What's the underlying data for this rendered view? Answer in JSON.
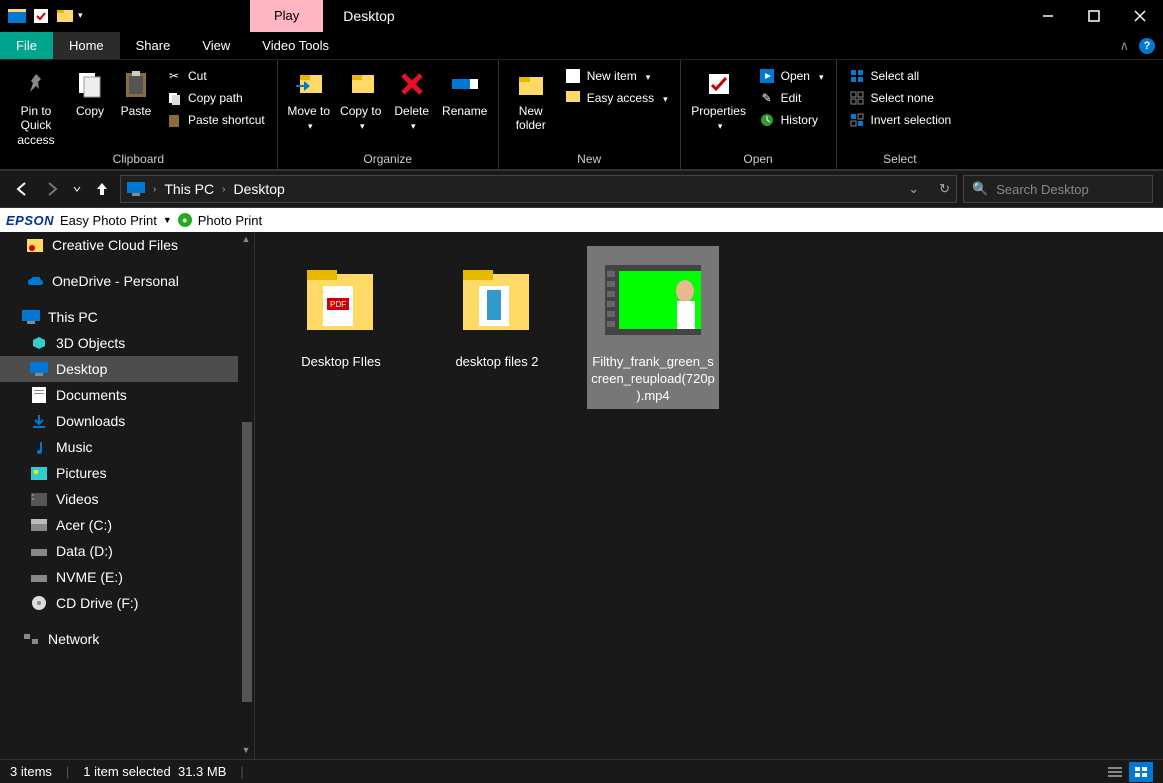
{
  "window": {
    "context_tab": "Play",
    "title": "Desktop"
  },
  "tabs": {
    "file": "File",
    "home": "Home",
    "share": "Share",
    "view": "View",
    "video_tools": "Video Tools"
  },
  "ribbon": {
    "clipboard": {
      "label": "Clipboard",
      "pin": "Pin to Quick access",
      "copy": "Copy",
      "paste": "Paste",
      "cut": "Cut",
      "copy_path": "Copy path",
      "paste_shortcut": "Paste shortcut"
    },
    "organize": {
      "label": "Organize",
      "move_to": "Move to",
      "copy_to": "Copy to",
      "delete": "Delete",
      "rename": "Rename"
    },
    "new": {
      "label": "New",
      "new_folder": "New folder",
      "new_item": "New item",
      "easy_access": "Easy access"
    },
    "open": {
      "label": "Open",
      "properties": "Properties",
      "open": "Open",
      "edit": "Edit",
      "history": "History"
    },
    "select": {
      "label": "Select",
      "select_all": "Select all",
      "select_none": "Select none",
      "invert": "Invert selection"
    }
  },
  "breadcrumb": {
    "root": "This PC",
    "current": "Desktop"
  },
  "search": {
    "placeholder": "Search Desktop"
  },
  "epson": {
    "brand": "EPSON",
    "easy": "Easy Photo Print",
    "photo": "Photo Print"
  },
  "tree": {
    "ccf": "Creative Cloud Files",
    "onedrive": "OneDrive - Personal",
    "thispc": "This PC",
    "objects3d": "3D Objects",
    "desktop": "Desktop",
    "documents": "Documents",
    "downloads": "Downloads",
    "music": "Music",
    "pictures": "Pictures",
    "videos": "Videos",
    "acer": "Acer (C:)",
    "data": "Data (D:)",
    "nvme": "NVME (E:)",
    "cd": "CD Drive (F:)",
    "network": "Network"
  },
  "files": [
    {
      "name": "Desktop FIles"
    },
    {
      "name": "desktop files 2"
    },
    {
      "name": "Filthy_frank_green_screen_reupload(720p).mp4"
    }
  ],
  "status": {
    "count": "3 items",
    "selected": "1 item selected",
    "size": "31.3 MB"
  }
}
